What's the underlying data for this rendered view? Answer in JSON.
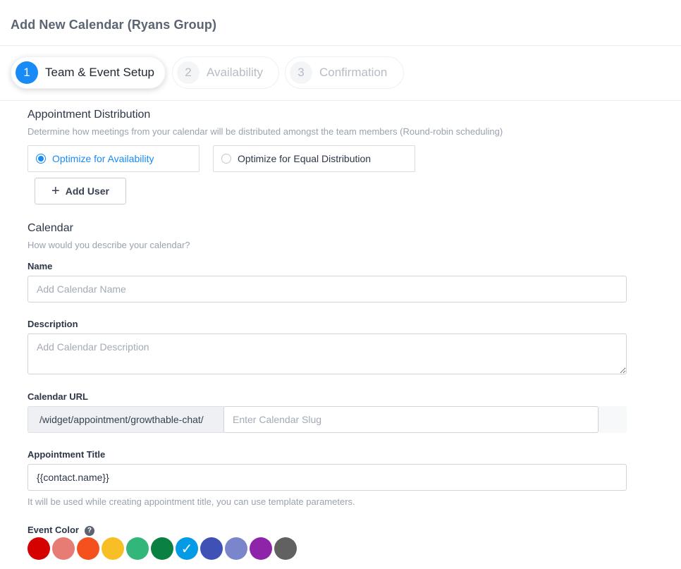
{
  "header": {
    "title": "Add New Calendar (Ryans Group)"
  },
  "steps": [
    {
      "number": "1",
      "label": "Team & Event Setup",
      "active": true
    },
    {
      "number": "2",
      "label": "Availability",
      "active": false
    },
    {
      "number": "3",
      "label": "Confirmation",
      "active": false
    }
  ],
  "distribution": {
    "title": "Appointment Distribution",
    "subtitle": "Determine how meetings from your calendar will be distributed amongst the team members (Round-robin scheduling)",
    "options": [
      {
        "label": "Optimize for Availability",
        "selected": true
      },
      {
        "label": "Optimize for Equal Distribution",
        "selected": false
      }
    ],
    "add_user_label": "Add User"
  },
  "calendar": {
    "title": "Calendar",
    "subtitle": "How would you describe your calendar?",
    "name_label": "Name",
    "name_placeholder": "Add Calendar Name",
    "description_label": "Description",
    "description_placeholder": "Add Calendar Description",
    "url_label": "Calendar URL",
    "url_prefix": "/widget/appointment/growthable-chat/",
    "slug_placeholder": "Enter Calendar Slug",
    "appt_title_label": "Appointment Title",
    "appt_title_value": "{{contact.name}}",
    "appt_title_help": "It will be used while creating appointment title, you can use template parameters.",
    "event_color_label": "Event Color",
    "help_icon_glyph": "?"
  },
  "colors": {
    "accent": "#188bf6",
    "event_colors": [
      "#d50000",
      "#e67c73",
      "#f4511e",
      "#f6bf26",
      "#33b679",
      "#0b8043",
      "#039be5",
      "#3f51b5",
      "#7986cb",
      "#8e24aa",
      "#616161"
    ],
    "selected_index": 6,
    "check_glyph": "✓"
  }
}
